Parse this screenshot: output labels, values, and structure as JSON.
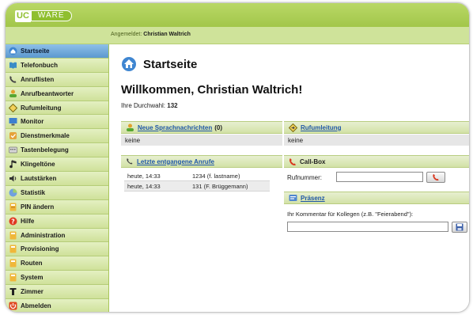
{
  "logo": {
    "uc": "UC",
    "ware": "WARE"
  },
  "header": {
    "logged_in_label": "Angemeldet:",
    "user": "Christian Waltrich"
  },
  "sidebar": {
    "items": [
      {
        "label": "Startseite",
        "icon": "home-icon",
        "active": true
      },
      {
        "label": "Telefonbuch",
        "icon": "phonebook-icon"
      },
      {
        "label": "Anruflisten",
        "icon": "call-list-icon"
      },
      {
        "label": "Anrufbeantworter",
        "icon": "voicemail-icon"
      },
      {
        "label": "Rufumleitung",
        "icon": "forward-icon"
      },
      {
        "label": "Monitor",
        "icon": "monitor-icon"
      },
      {
        "label": "Dienstmerkmale",
        "icon": "features-icon"
      },
      {
        "label": "Tastenbelegung",
        "icon": "keys-icon"
      },
      {
        "label": "Klingeltöne",
        "icon": "ringtone-icon"
      },
      {
        "label": "Lautstärken",
        "icon": "volume-icon"
      },
      {
        "label": "Statistik",
        "icon": "statistics-icon"
      },
      {
        "label": "PIN ändern",
        "icon": "pin-icon"
      },
      {
        "label": "Hilfe",
        "icon": "help-icon"
      },
      {
        "label": "Administration",
        "icon": "admin-icon"
      },
      {
        "label": "Provisioning",
        "icon": "provisioning-icon"
      },
      {
        "label": "Routen",
        "icon": "routes-icon"
      },
      {
        "label": "System",
        "icon": "system-icon"
      },
      {
        "label": "Zimmer",
        "icon": "room-icon"
      },
      {
        "label": "Abmelden",
        "icon": "logout-icon"
      }
    ]
  },
  "page": {
    "title": "Startseite",
    "welcome": "Willkommen, Christian Waltrich!",
    "durchwahl_label": "Ihre Durchwahl:",
    "durchwahl_value": "132"
  },
  "voicemail": {
    "title": "Neue Sprachnachrichten",
    "count": "(0)",
    "value": "keine"
  },
  "forwarding": {
    "title": "Rufumleitung",
    "value": "keine"
  },
  "missed_calls": {
    "title": "Letzte entgangene Anrufe",
    "rows": [
      {
        "time": "heute, 14:33",
        "caller": "1234 (f. lastname)"
      },
      {
        "time": "heute, 14:33",
        "caller": "131 (F. Brüggemann)"
      }
    ]
  },
  "callbox": {
    "title": "Call-Box",
    "number_label": "Rufnummer:",
    "number_value": ""
  },
  "presence": {
    "title": "Präsenz",
    "comment_label": "Ihr Kommentar für Kollegen (z.B. \"Feierabend\"):",
    "comment_value": ""
  },
  "colors": {
    "brand_green": "#a2c64a",
    "active_blue": "#5b98cf",
    "link_blue": "#1f57a8",
    "call_red": "#d9371f"
  }
}
